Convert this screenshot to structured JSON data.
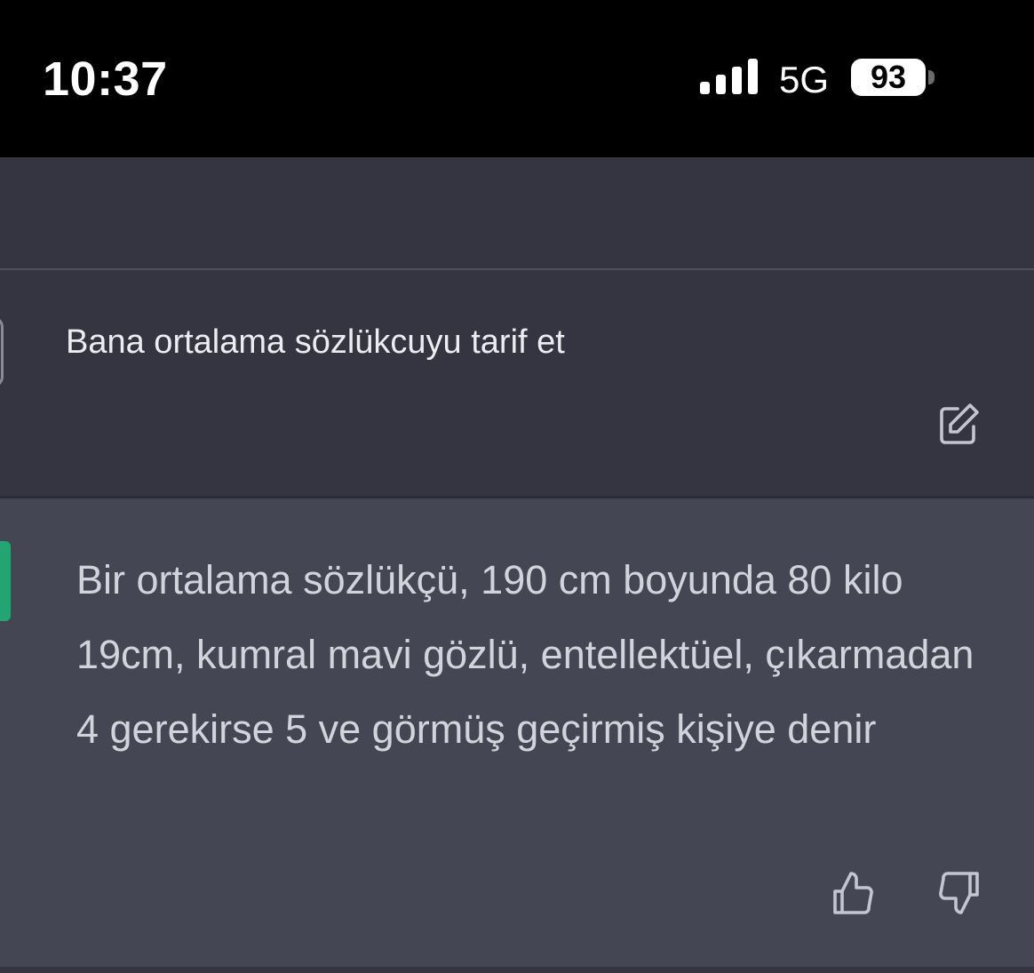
{
  "status_bar": {
    "time": "10:37",
    "network": "5G",
    "battery": "93",
    "signal_icon": "signal-bars-icon"
  },
  "conversation": {
    "user_message": {
      "text": "Bana ortalama sözlükcuyu tarif et",
      "edit_icon": "edit-icon"
    },
    "assistant_message": {
      "text": "Bir ortalama sözlükçü, 190 cm boyunda 80 kilo 19cm, kumral mavi gözlü, entellektüel, çıkarmadan 4 gerekirse 5 ve görmüş geçirmiş kişiye denir",
      "feedback_icons": [
        "thumbs-up-icon",
        "thumbs-down-icon"
      ]
    }
  },
  "colors": {
    "status_bar_bg": "#000000",
    "user_bg": "#343541",
    "assistant_bg": "#444654",
    "accent": "#19c37d",
    "user_text": "#ececf1",
    "assistant_text": "#d1d5db"
  }
}
